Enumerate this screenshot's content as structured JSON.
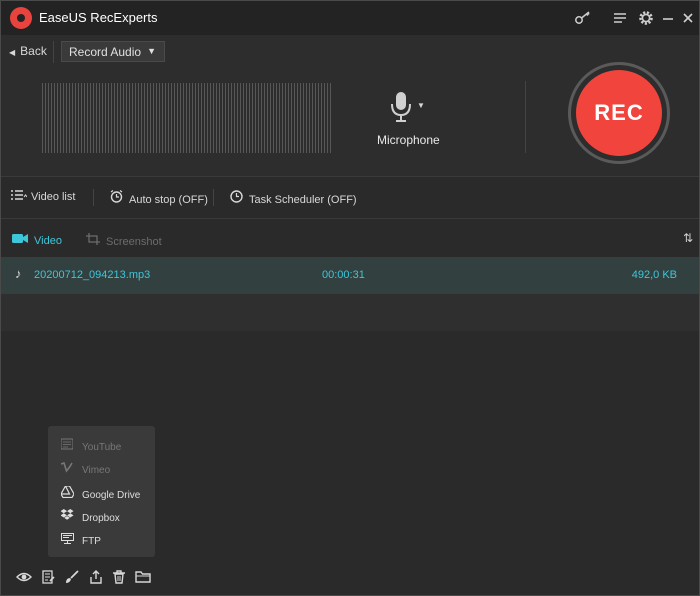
{
  "window": {
    "title": "EaseUS RecExperts"
  },
  "titlebar_icons": [
    "key-icon",
    "menu-icon",
    "gear-icon",
    "minimize-icon",
    "close-icon"
  ],
  "recorder": {
    "back_label": "Back",
    "mode_selected": "Record Audio",
    "mic_label": "Microphone",
    "rec_label": "REC"
  },
  "toolbar": {
    "video_list_label": "Video list",
    "auto_stop_label": "Auto stop (OFF)",
    "task_scheduler_label": "Task Scheduler (OFF)"
  },
  "tabs": {
    "video_label": "Video",
    "screenshot_label": "Screenshot"
  },
  "files": [
    {
      "name": "20200712_094213.mp3",
      "duration": "00:00:31",
      "size": "492,0 KB"
    }
  ],
  "share_menu": {
    "items": [
      {
        "label": "YouTube",
        "icon": "youtube-icon",
        "enabled": false
      },
      {
        "label": "Vimeo",
        "icon": "vimeo-icon",
        "enabled": false
      },
      {
        "label": "Google Drive",
        "icon": "google-drive-icon",
        "enabled": true
      },
      {
        "label": "Dropbox",
        "icon": "dropbox-icon",
        "enabled": true
      },
      {
        "label": "FTP",
        "icon": "ftp-icon",
        "enabled": true
      }
    ]
  },
  "actions": [
    "preview-icon",
    "edit-icon",
    "brush-icon",
    "share-icon",
    "delete-icon",
    "folder-icon"
  ],
  "colors": {
    "accent": "#3ec6d9",
    "rec": "#f0443c",
    "background": "#2a2a2a"
  }
}
